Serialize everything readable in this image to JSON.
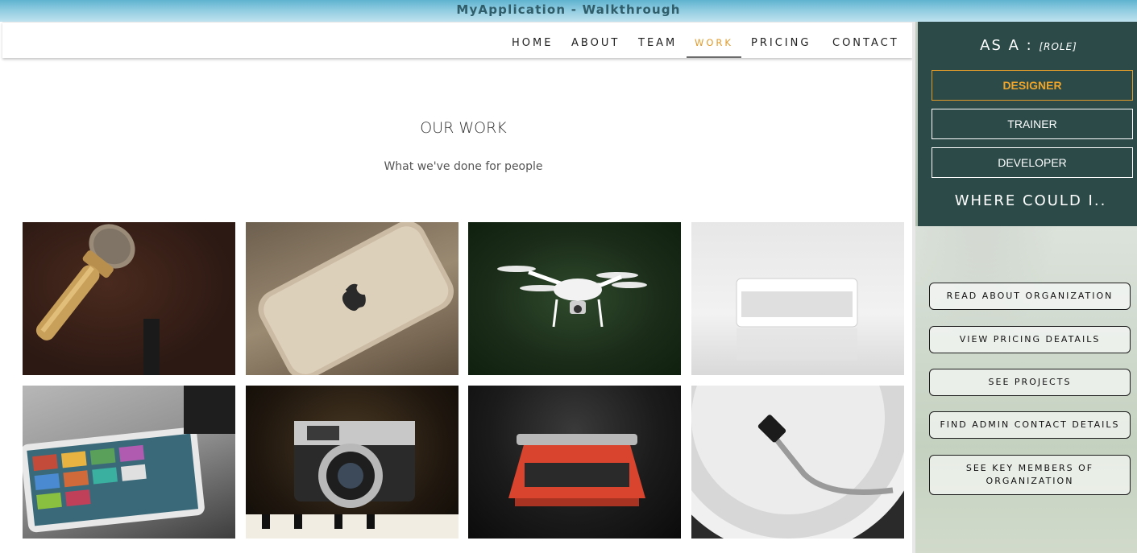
{
  "window": {
    "title": "MyApplication - Walkthrough"
  },
  "nav": {
    "items": [
      {
        "label": "HOME"
      },
      {
        "label": "ABOUT"
      },
      {
        "label": "TEAM"
      },
      {
        "label": "WORK",
        "active": true
      },
      {
        "label": "PRICING"
      },
      {
        "label": "CONTACT"
      }
    ]
  },
  "work": {
    "title": "OUR WORK",
    "subtitle": "What we've done for people",
    "tiles": [
      {
        "icon": "microphone-image"
      },
      {
        "icon": "smartphone-image"
      },
      {
        "icon": "drone-image"
      },
      {
        "icon": "speaker-image"
      },
      {
        "icon": "tablet-laptop-image"
      },
      {
        "icon": "camera-image"
      },
      {
        "icon": "typewriter-image"
      },
      {
        "icon": "turntable-image"
      }
    ]
  },
  "panel": {
    "as_a_label": "AS A :",
    "role_placeholder": "[ROLE]",
    "roles": [
      {
        "label": "DESIGNER",
        "selected": true
      },
      {
        "label": "TRAINER",
        "selected": false
      },
      {
        "label": "DEVELOPER",
        "selected": false
      }
    ],
    "where_label": "WHERE COULD I..",
    "actions": [
      {
        "label": "READ ABOUT ORGANIZATION"
      },
      {
        "label": "VIEW PRICING DEATAILS"
      },
      {
        "label": "SEE PROJECTS"
      },
      {
        "label": "FIND ADMIN CONTACT DETAILS"
      },
      {
        "label": "SEE KEY MEMBERS OF ORGANIZATION"
      }
    ]
  },
  "colors": {
    "accent": "#e09b2d",
    "panel_dark": "#2b4a48",
    "title_text": "#2f5d6a"
  }
}
